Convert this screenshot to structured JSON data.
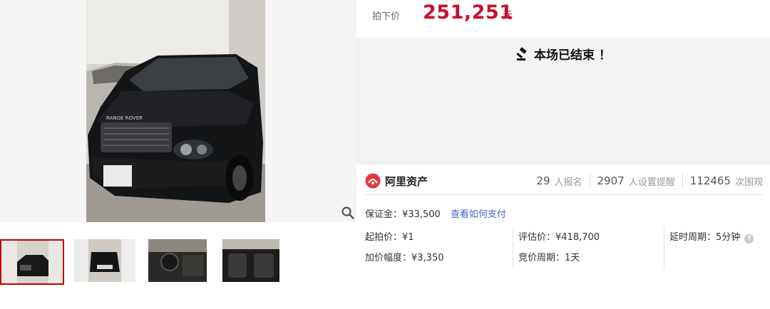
{
  "price": {
    "label": "拍下价",
    "value": "251,251",
    "unit": "元"
  },
  "status": {
    "icon": "gavel-icon",
    "text": "本场已结束 ！"
  },
  "brand": {
    "name": "阿里资产",
    "color": "#e4393c"
  },
  "stats": [
    {
      "number": "29",
      "label": "人报名"
    },
    {
      "number": "2907",
      "label": "人设置提醒"
    },
    {
      "number": "112465",
      "label": "次围观"
    }
  ],
  "deposit": {
    "label": "保证金：¥33,500",
    "link": "查看如何支付"
  },
  "info": {
    "start_price": "起拍价：¥1",
    "increment": "加价幅度：¥3,350",
    "appraisal": "评估价：¥418,700",
    "bid_cycle": "竞价周期：1天",
    "delay_cycle": "延时周期：5分钟",
    "help": "?"
  },
  "colors": {
    "price_red": "#c8102e",
    "link_blue": "#3a6bc5",
    "active_thumb_border": "#c40000"
  }
}
